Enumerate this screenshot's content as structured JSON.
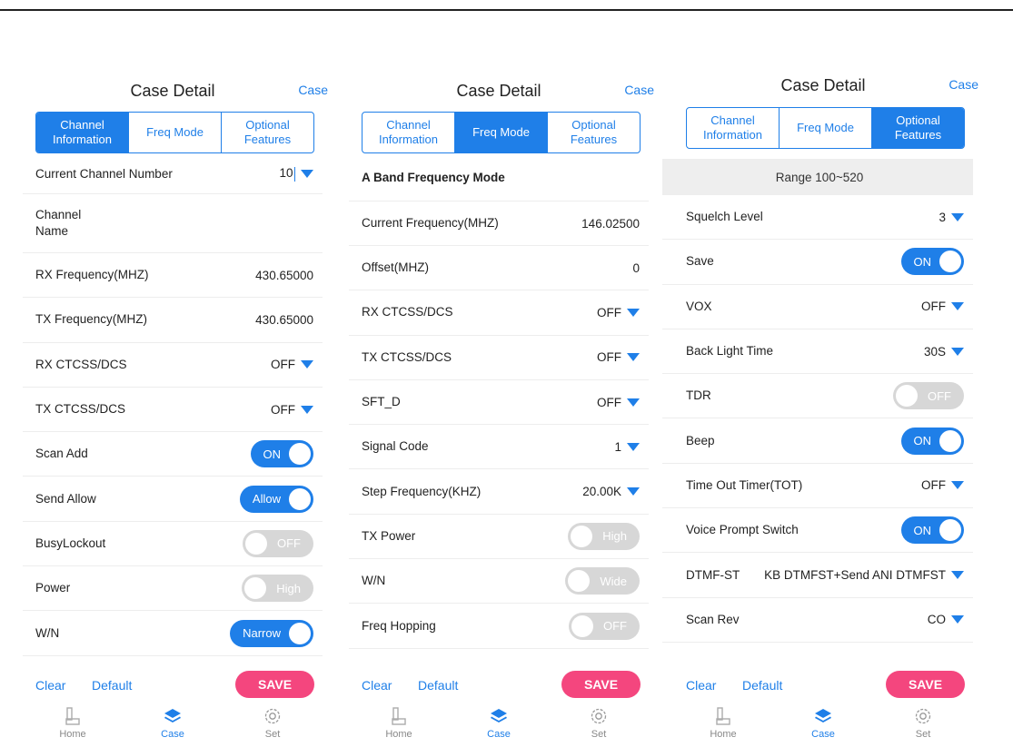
{
  "header": {
    "title": "Case Detail",
    "link": "Case"
  },
  "colors": {
    "accent": "#1f7fe8",
    "save": "#f4467e",
    "toggle_off": "#d7d7d7"
  },
  "footer": {
    "clear": "Clear",
    "default": "Default",
    "save": "SAVE"
  },
  "nav": {
    "home": "Home",
    "case": "Case",
    "set": "Set"
  },
  "tabs": {
    "channel": "Channel Information",
    "freq": "Freq Mode",
    "optional": "Optional Features"
  },
  "panel1": {
    "rows": {
      "current_channel": {
        "label": "Current Channel Number",
        "value": "10"
      },
      "channel_name": {
        "label": "Channel\nName"
      },
      "rx_freq": {
        "label": "RX Frequency(MHZ)",
        "value": "430.65000"
      },
      "tx_freq": {
        "label": "TX Frequency(MHZ)",
        "value": "430.65000"
      },
      "rx_ctcss": {
        "label": "RX CTCSS/DCS",
        "value": "OFF"
      },
      "tx_ctcss": {
        "label": "TX CTCSS/DCS",
        "value": "OFF"
      },
      "scan_add": {
        "label": "Scan Add",
        "value": "ON"
      },
      "send_allow": {
        "label": "Send Allow",
        "value": "Allow"
      },
      "busy_lockout": {
        "label": "BusyLockout",
        "value": "OFF"
      },
      "power": {
        "label": "Power",
        "value": "High"
      },
      "wn": {
        "label": "W/N",
        "value": "Narrow"
      }
    }
  },
  "panel2": {
    "rows": {
      "band": {
        "label": "A Band Frequency Mode"
      },
      "current_freq": {
        "label": "Current Frequency(MHZ)",
        "value": "146.02500"
      },
      "offset": {
        "label": "Offset(MHZ)",
        "value": "0"
      },
      "rx_ctcss": {
        "label": "RX CTCSS/DCS",
        "value": "OFF"
      },
      "tx_ctcss": {
        "label": "TX CTCSS/DCS",
        "value": "OFF"
      },
      "sft_d": {
        "label": "SFT_D",
        "value": "OFF"
      },
      "signal_code": {
        "label": "Signal Code",
        "value": "1"
      },
      "step_freq": {
        "label": "Step Frequency(KHZ)",
        "value": "20.00K"
      },
      "tx_power": {
        "label": "TX Power",
        "value": "High"
      },
      "wn": {
        "label": "W/N",
        "value": "Wide"
      },
      "freq_hopping": {
        "label": "Freq Hopping",
        "value": "OFF"
      }
    }
  },
  "panel3": {
    "range": "Range 100~520",
    "rows": {
      "squelch": {
        "label": "Squelch Level",
        "value": "3"
      },
      "save": {
        "label": "Save",
        "value": "ON"
      },
      "vox": {
        "label": "VOX",
        "value": "OFF"
      },
      "backlight": {
        "label": "Back Light Time",
        "value": "30S"
      },
      "tdr": {
        "label": "TDR",
        "value": "OFF"
      },
      "beep": {
        "label": "Beep",
        "value": "ON"
      },
      "tot": {
        "label": "Time Out Timer(TOT)",
        "value": "OFF"
      },
      "voice": {
        "label": "Voice Prompt Switch",
        "value": "ON"
      },
      "dtmf": {
        "label": "DTMF-ST",
        "value": "KB DTMFST+Send ANI DTMFST"
      },
      "scan_rev": {
        "label": "Scan Rev",
        "value": "CO"
      }
    }
  }
}
